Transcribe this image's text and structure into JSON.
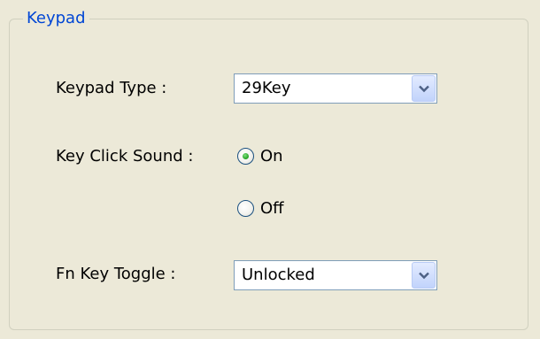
{
  "group": {
    "title": "Keypad"
  },
  "keypad_type": {
    "label": "Keypad Type :",
    "selected": "29Key"
  },
  "key_click_sound": {
    "label": "Key Click Sound :",
    "options": [
      {
        "label": "On",
        "checked": true
      },
      {
        "label": "Off",
        "checked": false
      }
    ]
  },
  "fn_key_toggle": {
    "label": "Fn Key Toggle :",
    "selected": "Unlocked"
  },
  "icons": {
    "dropdown": "chevron-down-icon"
  },
  "colors": {
    "legend": "#0046d5",
    "background": "#ece9d8",
    "radio_selected": "#21a121"
  }
}
